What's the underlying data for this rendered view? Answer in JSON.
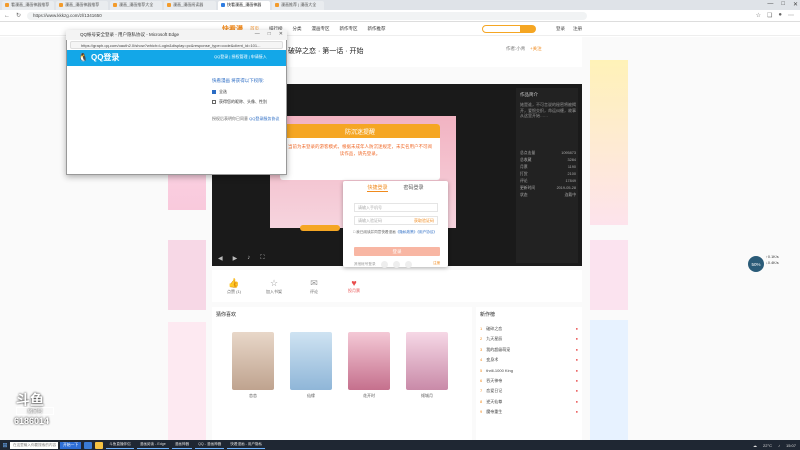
{
  "browser": {
    "tabs": [
      {
        "label": "看漫画_漫画神器推荐"
      },
      {
        "label": "漫画_漫画神器推荐"
      },
      {
        "label": "漫画_漫画推荐大全"
      },
      {
        "label": "漫画_漫画阅读器"
      },
      {
        "label": "快看漫画_漫画神器"
      },
      {
        "label": "漫画推荐 | 漫画大全"
      }
    ],
    "url": "https://www.kkkzg.com/zl/1341650",
    "window_controls": [
      "—",
      "□",
      "✕"
    ]
  },
  "site": {
    "logo": "快看漫",
    "nav": [
      "首页",
      "排行榜",
      "分类",
      "漫画专区",
      "新作专区",
      "新作推荐"
    ],
    "user_links": [
      "登录",
      "注册"
    ],
    "work_title": "破碎之恋 · 第一话 · 开始",
    "author": "作者:小青",
    "follow": "+关注"
  },
  "reader": {
    "notice_title": "防沉迷提醒",
    "notice_text": "当前为未登录的游客模式，根据未成年人防沉迷规定，未实名用户不可阅读作品，请先登录。"
  },
  "info_panel": {
    "title": "作品简介",
    "desc": "她是谁，不可言说的秘密将被揭开，爱恨交织，命运纠缠，故事从这里开始……",
    "rows": [
      {
        "k": "总点击量",
        "v": "1095873"
      },
      {
        "k": "总收藏",
        "v": "3284"
      },
      {
        "k": "月票",
        "v": "1190"
      },
      {
        "k": "打赏",
        "v": "2100"
      },
      {
        "k": "评论",
        "v": "17849"
      },
      {
        "k": "更新时间",
        "v": "2019-05-28"
      },
      {
        "k": "状态",
        "v": "连载中"
      }
    ]
  },
  "actions": [
    {
      "icon": "👍",
      "label": "点赞 (1)"
    },
    {
      "icon": "☆",
      "label": "加入书架"
    },
    {
      "icon": "✉",
      "label": "评论"
    },
    {
      "icon": "♥",
      "label": "投月票"
    }
  ],
  "recommend": {
    "title": "猜你喜欢",
    "items": [
      "恋恋",
      "仙缘",
      "花开时",
      "倾城月"
    ]
  },
  "ranking": {
    "title": "新作榜",
    "items": [
      "破碎之恋",
      "九天星辰",
      "我的超级萌宠",
      "变身术",
      "thrill-1000 King",
      "吞天神帝",
      "恋爱日记",
      "逆天仙尊",
      "魔帝重生"
    ]
  },
  "qq_window": {
    "title": "QQ帐号安全登录 - 用户隐私协议 - Microsoft Edge",
    "url": "https://graph.qq.com/oauth2.0/show?which=Login&display=pc&response_type=code&client_id=101...",
    "brand": "QQ登录",
    "header_link": "QQ登录 | 授权管理 | 申请接入",
    "site_title": "快看漫画 将获得以下权限:",
    "opt1": "全选",
    "opt2": "获得您的昵称、头像、性别",
    "footer_text": "授权后表明你已同意",
    "footer_link": "QQ登录服务协议"
  },
  "login_modal": {
    "tab_fast": "快捷登录",
    "tab_account": "密码登录",
    "phone_placeholder": "请输入手机号",
    "code_placeholder": "请输入验证码",
    "get_code": "获取验证码",
    "agree_text": "我已阅读并同意快看漫画",
    "agree_link1": "《隐私政策》",
    "agree_link2": "《用户协议》",
    "login_btn": "登录",
    "other_login": "其他帐号登录",
    "register": "注册"
  },
  "speed_widget": {
    "value": "50%",
    "up": "↑0.1K/s",
    "down": "↓0.4K/s"
  },
  "douyu": {
    "logo": "斗鱼",
    "tag": "房间号",
    "room": "6186014"
  },
  "taskbar": {
    "search_placeholder": "在这里输入你要搜索的内容",
    "search_btn": "开始一下",
    "apps": [
      "斗鱼直播伴侣",
      "漫画阅读 - Edge",
      "漫画神器",
      "QQ - 漫画神器",
      "快看漫画 - 用户隐私"
    ],
    "weather": "22°C",
    "time": "15:07"
  }
}
